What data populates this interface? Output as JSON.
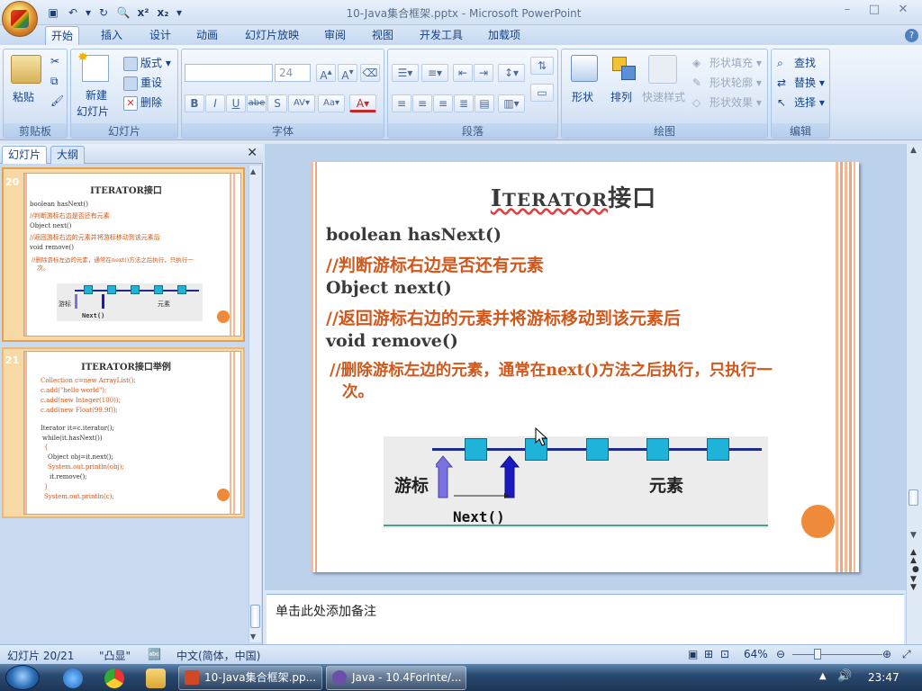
{
  "window": {
    "title": "10-Java集合框架.pptx - Microsoft PowerPoint",
    "controls": [
      "–",
      "□",
      "✕"
    ]
  },
  "qat": {
    "items": [
      "save-icon",
      "undo-icon",
      "redo-icon",
      "print-preview-icon",
      "superscript",
      "subscript",
      "customize"
    ],
    "superscript_label": "x²",
    "subscript_label": "x₂"
  },
  "ribbon": {
    "tabs": [
      "开始",
      "插入",
      "设计",
      "动画",
      "幻灯片放映",
      "审阅",
      "视图",
      "开发工具",
      "加载项"
    ],
    "active_tab": "开始",
    "clipboard": {
      "label": "剪贴板",
      "paste": "粘贴"
    },
    "slides": {
      "label": "幻灯片",
      "new_slide_line1": "新建",
      "new_slide_line2": "幻灯片",
      "layout": "版式",
      "reset": "重设",
      "delete": "删除"
    },
    "font": {
      "label": "字体",
      "font_name": "",
      "font_size": "24"
    },
    "paragraph": {
      "label": "段落"
    },
    "drawing": {
      "label": "绘图",
      "shapes": "形状",
      "arrange": "排列",
      "quick_styles": "快速样式",
      "shape_fill": "形状填充",
      "shape_outline": "形状轮廓",
      "shape_effects": "形状效果"
    },
    "editing": {
      "label": "编辑",
      "find": "查找",
      "replace": "替换",
      "select": "选择"
    }
  },
  "pane": {
    "tabs": [
      "幻灯片",
      "大纲"
    ],
    "active_tab": "幻灯片",
    "slides": [
      {
        "number": "20",
        "title": "ITERATOR接口",
        "lines": [
          "boolean hasNext()",
          "//判断游标右边是否还有元素",
          "Object next()",
          "//返回游标右边的元素并将游标移动到该元素后",
          "void remove()",
          "//删除游标左边的元素，通常在next()方法之后执行，只执行一",
          "次。"
        ],
        "diagram": {
          "cursor": "游标",
          "element": "元素",
          "next": "Next()"
        }
      },
      {
        "number": "21",
        "title": "ITERATOR接口举例",
        "lines": [
          "Collection c=new ArrayList();",
          "c.add(\"hello world\");",
          "c.add(new Integer(100));",
          "c.add(new Float(99.9f));",
          "Iterator it=c.iterator();",
          "while(it.hasNext())",
          "{",
          "Object obj=it.next();",
          "System.out.println(obj);",
          "it.remove();",
          "}",
          "System.out.println(c);"
        ]
      }
    ]
  },
  "slide": {
    "title_big": "I",
    "title_small": "TERATOR",
    "title_cn": "接口",
    "lines": [
      {
        "text": "boolean hasNext()",
        "color": "dark"
      },
      {
        "text": "//判断游标右边是否还有元素",
        "color": "orange"
      },
      {
        "text": "Object next()",
        "color": "dark"
      },
      {
        "text": "//返回游标右边的元素并将游标移动到该元素后",
        "color": "orange"
      },
      {
        "text": "void remove()",
        "color": "dark"
      },
      {
        "text": "//删除游标左边的元素，通常在next()方法之后执行，只执行一",
        "color": "orange"
      },
      {
        "text": "次。",
        "color": "orange"
      }
    ],
    "diagram": {
      "cursor_label": "游标",
      "element_label": "元素",
      "next_label": "Next()",
      "box_count": 5
    },
    "colors": {
      "accent": "#d2571b",
      "box": "#1fb3d9",
      "line": "#1e2a8c",
      "dot": "#ef8a3b"
    }
  },
  "notes": {
    "placeholder": "单击此处添加备注"
  },
  "status": {
    "slide_info": "幻灯片 20/21",
    "theme": "\"凸显\"",
    "language": "中文(简体，中国)",
    "zoom": "64%"
  },
  "taskbar": {
    "items": [
      {
        "label": "10-Java集合框架.pp...",
        "icon": "powerpoint-icon"
      },
      {
        "label": "Java - 10.4ForInte/...",
        "icon": "eclipse-icon"
      }
    ],
    "clock": "23:47"
  }
}
